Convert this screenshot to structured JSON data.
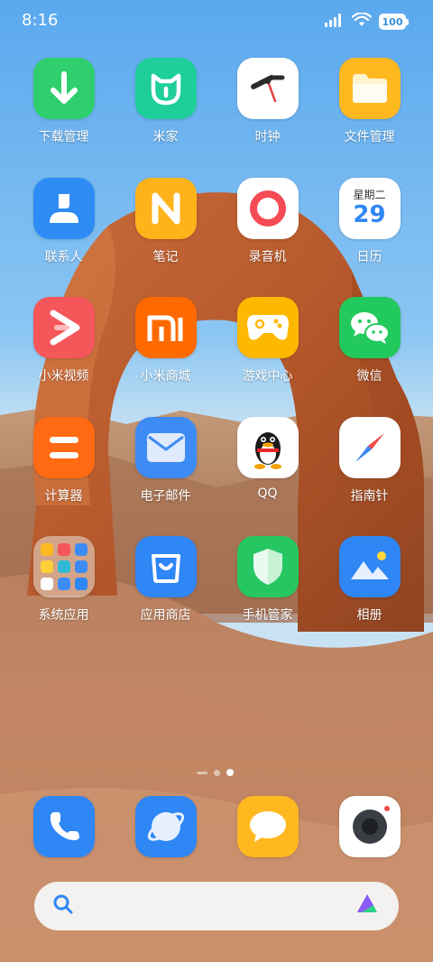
{
  "status_bar": {
    "time": "8:16",
    "battery": "100"
  },
  "apps": [
    {
      "label": "下载管理",
      "icon": "download-icon",
      "color": "#2fcf6e"
    },
    {
      "label": "米家",
      "icon": "mijia-icon",
      "color": "#1fcf9a"
    },
    {
      "label": "时钟",
      "icon": "clock-icon",
      "color": "#ffffff"
    },
    {
      "label": "文件管理",
      "icon": "folder-icon",
      "color": "#ffb81f"
    },
    {
      "label": "联系人",
      "icon": "contacts-icon",
      "color": "#2f8cf5"
    },
    {
      "label": "笔记",
      "icon": "notes-icon",
      "color": "#ffb31a"
    },
    {
      "label": "录音机",
      "icon": "recorder-icon",
      "color": "#ffffff"
    },
    {
      "label": "日历",
      "icon": "calendar-icon",
      "color": "#ffffff",
      "weekday": "星期二",
      "day": "29"
    },
    {
      "label": "小米视频",
      "icon": "video-icon",
      "color": "#f5565a"
    },
    {
      "label": "小米商城",
      "icon": "mi-store-icon",
      "color": "#ff6a00"
    },
    {
      "label": "游戏中心",
      "icon": "gamepad-icon",
      "color": "#ffb800"
    },
    {
      "label": "微信",
      "icon": "wechat-icon",
      "color": "#22c95c"
    },
    {
      "label": "计算器",
      "icon": "calculator-icon",
      "color": "#ff6a12"
    },
    {
      "label": "电子邮件",
      "icon": "mail-icon",
      "color": "#3d8cf5"
    },
    {
      "label": "QQ",
      "icon": "qq-penguin-icon",
      "color": "#ffffff"
    },
    {
      "label": "指南针",
      "icon": "compass-icon",
      "color": "#ffffff"
    },
    {
      "label": "系统应用",
      "icon": "folder-grid-icon",
      "color": "#ebe1d7"
    },
    {
      "label": "应用商店",
      "icon": "app-store-icon",
      "color": "#2f86f5"
    },
    {
      "label": "手机管家",
      "icon": "security-shield-icon",
      "color": "#26c762"
    },
    {
      "label": "相册",
      "icon": "gallery-icon",
      "color": "#2f86f5"
    }
  ],
  "dock": [
    {
      "icon": "phone-icon",
      "color": "#2f86f5"
    },
    {
      "icon": "browser-icon",
      "color": "#2f86f5"
    },
    {
      "icon": "messages-icon",
      "color": "#ffb81f"
    },
    {
      "icon": "camera-icon",
      "color": "#ffffff"
    }
  ],
  "page_indicator": {
    "pages": 2,
    "active": 2
  }
}
